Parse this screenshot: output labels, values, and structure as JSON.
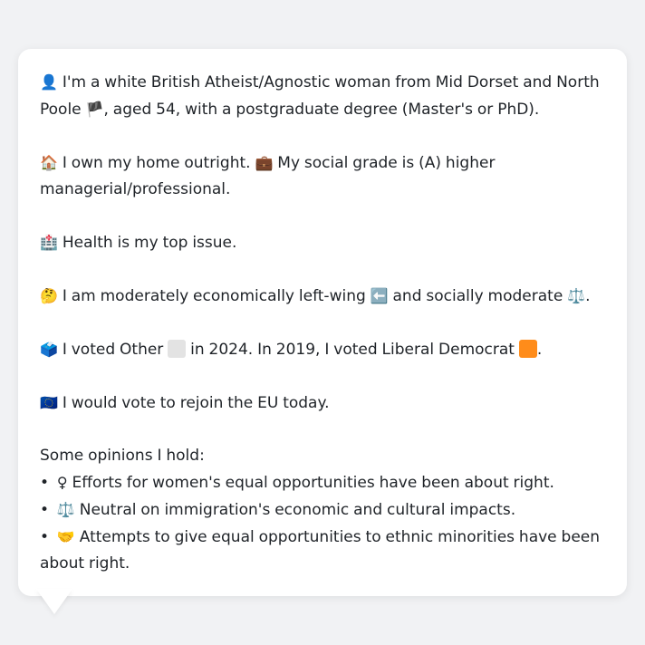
{
  "profile": {
    "identity": {
      "icon": "👤",
      "line1": "I'm a white British Atheist/Agnostic woman from Mid Dorset and North",
      "line2_start": "Poole",
      "flag": "🏴",
      "line2_end": ", aged 54, with a postgraduate degree (Master's or PhD)."
    },
    "home": {
      "icon": "🏠",
      "text1": "I own my home outright.",
      "icon2": "💼",
      "text2": "My social grade is (A) higher",
      "text3": "managerial/professional."
    },
    "issue": {
      "icon": "🏥",
      "text": "Health is my top issue."
    },
    "ideology": {
      "icon": "🤔",
      "text1": "I am moderately economically left-wing",
      "icon2": "⬅️",
      "text2": "and socially moderate",
      "icon3": "⚖️",
      "end": "."
    },
    "vote": {
      "icon": "🗳️",
      "text1": "I voted Other",
      "other_color": "#e3e3e3",
      "text2": "in 2024. In 2019, I voted Liberal Democrat",
      "libdem_color": "#ff8c1a",
      "end": "."
    },
    "eu": {
      "icon": "🇪🇺",
      "text": "I would vote to rejoin the EU today."
    },
    "opinions": {
      "heading": "Some opinions I hold:",
      "bullet": "•",
      "items": [
        {
          "icon": "♀",
          "text": "Efforts for women's equal opportunities have been about right."
        },
        {
          "icon": "⚖️",
          "text": "Neutral on immigration's economic and cultural impacts."
        },
        {
          "icon": "🤝",
          "text": "Attempts to give equal opportunities to ethnic minorities have been"
        }
      ],
      "item3_cont": "about right."
    }
  }
}
